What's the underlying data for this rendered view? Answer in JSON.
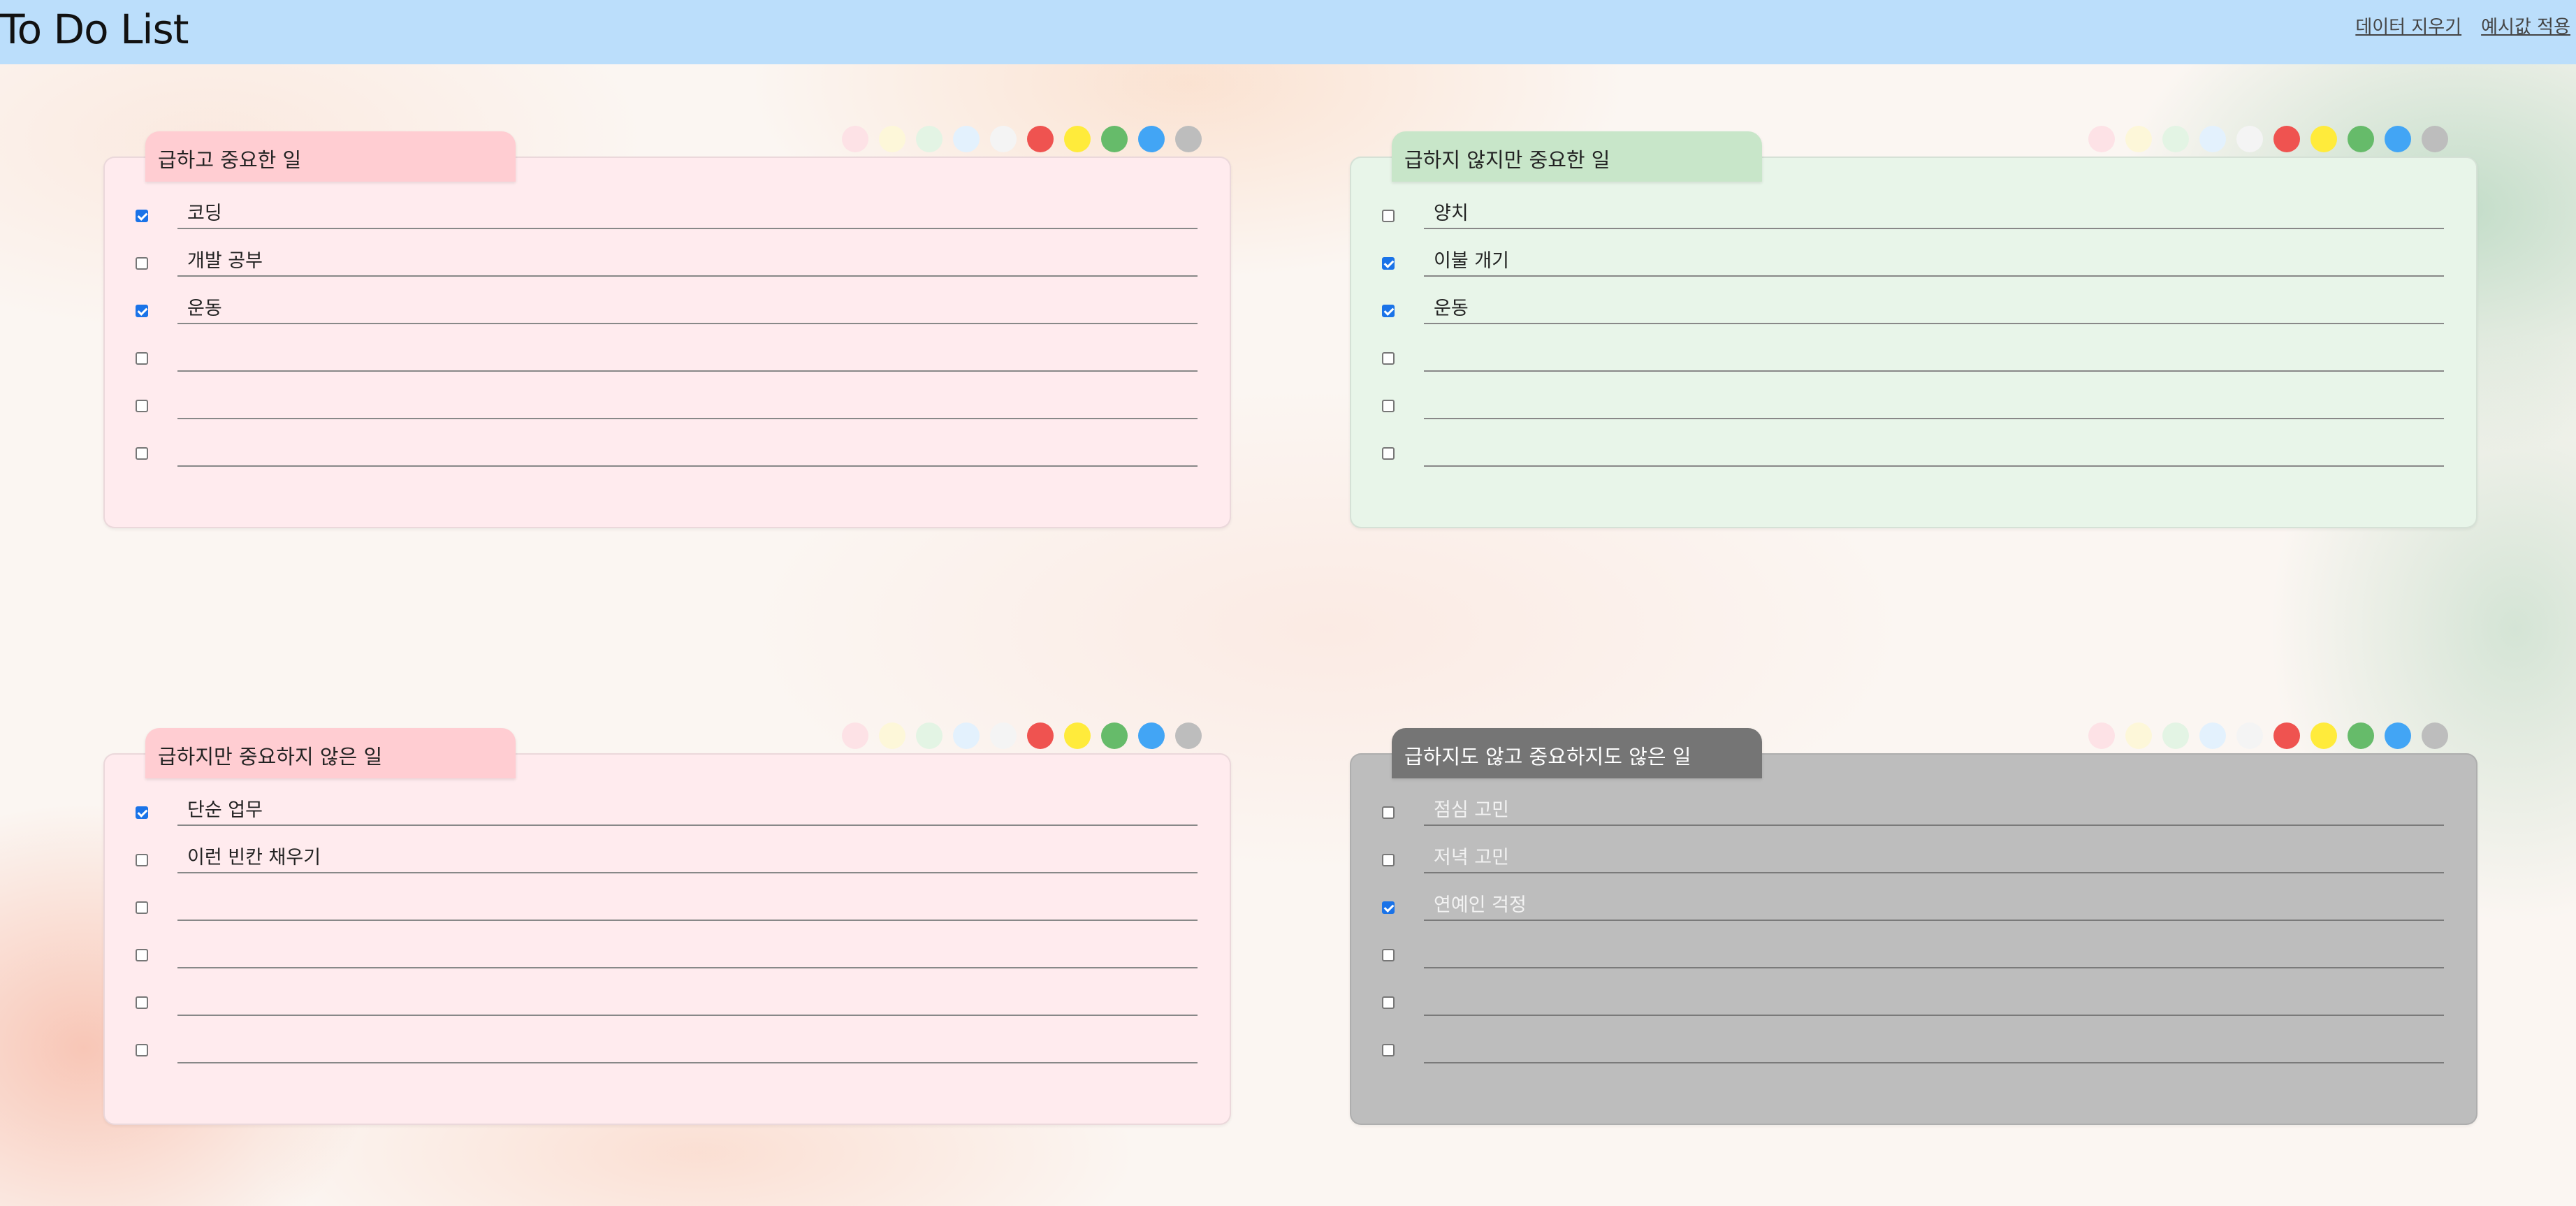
{
  "app": {
    "title": "To Do List",
    "actions": {
      "clear_data": "데이터 지우기",
      "apply_example": "예시값 적용"
    }
  },
  "swatch_colors": [
    "#fde2e6",
    "#fdf7d9",
    "#e3f4e4",
    "#e3f1fd",
    "#f4f4f4",
    "#ef5350",
    "#ffeb3b",
    "#66bb6a",
    "#42a5f5",
    "#bdbdbd"
  ],
  "quadrants": [
    {
      "title": "급하고 중요한 일",
      "tab_color": "#ffcdd2",
      "panel_color": "#ffebee",
      "items": [
        {
          "text": "코딩",
          "checked": true
        },
        {
          "text": "개발 공부",
          "checked": false
        },
        {
          "text": "운동",
          "checked": true
        },
        {
          "text": "",
          "checked": false
        },
        {
          "text": "",
          "checked": false
        },
        {
          "text": "",
          "checked": false
        }
      ]
    },
    {
      "title": "급하지 않지만 중요한 일",
      "tab_color": "#c8e6c9",
      "panel_color": "#e8f5e9",
      "items": [
        {
          "text": "양치",
          "checked": false
        },
        {
          "text": "이불 개기",
          "checked": true
        },
        {
          "text": "운동",
          "checked": true
        },
        {
          "text": "",
          "checked": false
        },
        {
          "text": "",
          "checked": false
        },
        {
          "text": "",
          "checked": false
        }
      ]
    },
    {
      "title": "급하지만 중요하지 않은 일",
      "tab_color": "#ffcdd2",
      "panel_color": "#ffebee",
      "items": [
        {
          "text": "단순 업무",
          "checked": true
        },
        {
          "text": "이런 빈칸 채우기",
          "checked": false
        },
        {
          "text": "",
          "checked": false
        },
        {
          "text": "",
          "checked": false
        },
        {
          "text": "",
          "checked": false
        },
        {
          "text": "",
          "checked": false
        }
      ]
    },
    {
      "title": "급하지도 않고 중요하지도 않은 일",
      "tab_color": "#757575",
      "panel_color": "#bdbdbd",
      "title_color": "#ffffff",
      "items": [
        {
          "text": "점심 고민",
          "checked": false
        },
        {
          "text": "저녁 고민",
          "checked": false
        },
        {
          "text": "연예인 걱정",
          "checked": true
        },
        {
          "text": "",
          "checked": false
        },
        {
          "text": "",
          "checked": false
        },
        {
          "text": "",
          "checked": false
        }
      ]
    }
  ]
}
